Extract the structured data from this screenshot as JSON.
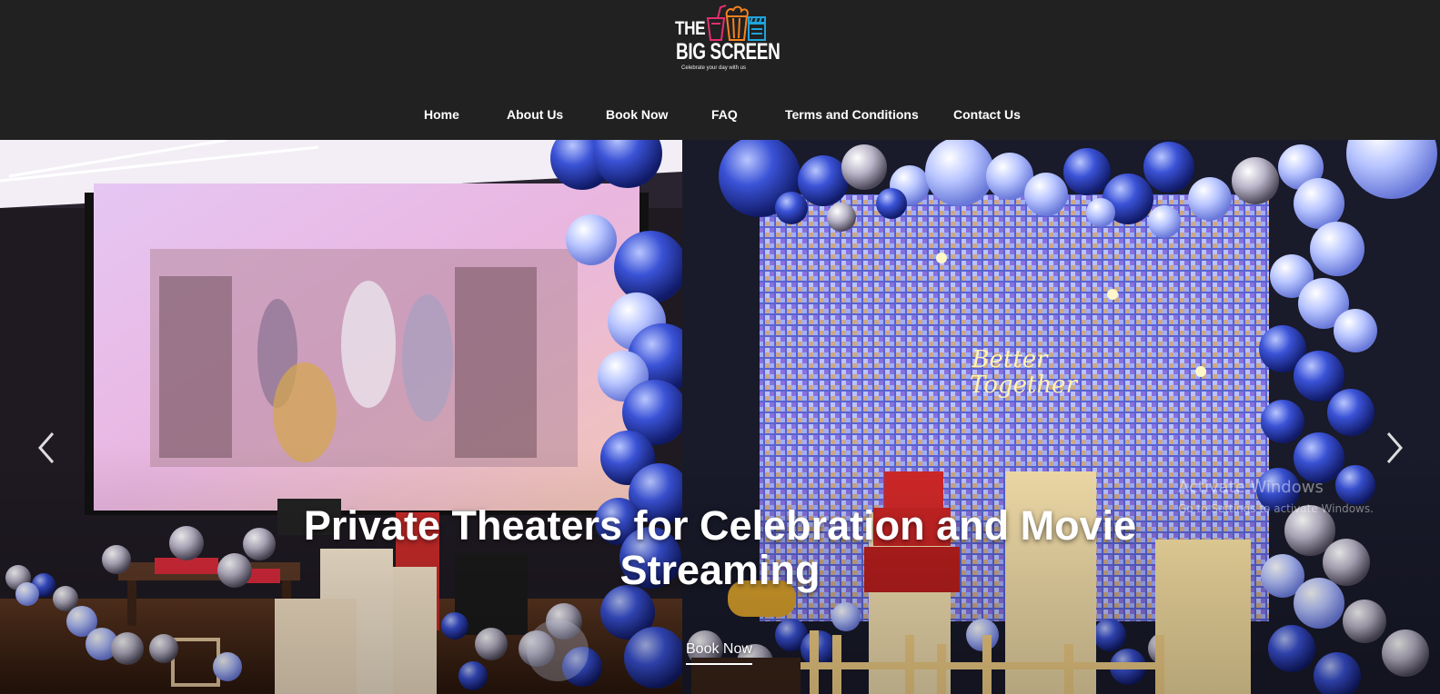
{
  "brand": {
    "line1": "THE",
    "line2": "BIG SCREEN",
    "tagline": "Celebrate your day with us",
    "icons": [
      "drink-cup-icon",
      "popcorn-icon",
      "clapperboard-icon"
    ],
    "colors": {
      "cup": "#e52e71",
      "popcorn": "#f58220",
      "clapper": "#1fa4dc"
    }
  },
  "nav": {
    "items": [
      {
        "label": "Home"
      },
      {
        "label": "About Us"
      },
      {
        "label": "Book Now"
      },
      {
        "label": "FAQ"
      },
      {
        "label": "Terms and Conditions"
      },
      {
        "label": "Contact Us"
      }
    ]
  },
  "hero": {
    "title": "Private Theaters for Celebration and Movie Streaming",
    "cta_label": "Book Now",
    "prev_icon": "chevron-left-icon",
    "next_icon": "chevron-right-icon",
    "neon_sign": "Better Together"
  },
  "watermark": {
    "title": "Activate Windows",
    "subtitle": "Go to Settings to activate Windows."
  },
  "colors": {
    "header_bg": "#212121",
    "text": "#ffffff",
    "balloon_blue": "#2b3fb8",
    "balloon_light": "#a9b6ff"
  }
}
